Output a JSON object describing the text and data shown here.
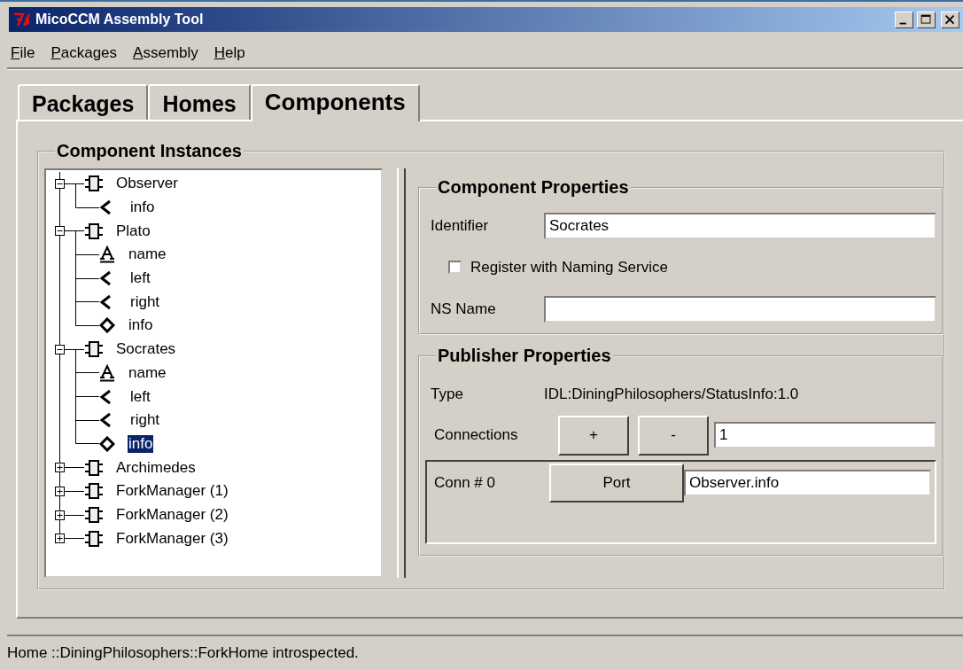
{
  "window": {
    "title": "MicoCCM Assembly Tool"
  },
  "menu": [
    {
      "label": "File"
    },
    {
      "label": "Packages"
    },
    {
      "label": "Assembly"
    },
    {
      "label": "Help"
    }
  ],
  "tabs": [
    {
      "label": "Packages",
      "selected": false
    },
    {
      "label": "Homes",
      "selected": false
    },
    {
      "label": "Components",
      "selected": true
    }
  ],
  "component_instances": {
    "title": "Component Instances",
    "tree": [
      {
        "label": "Observer",
        "kind": "component",
        "expanded": true,
        "selected": false,
        "children": [
          {
            "label": "info",
            "kind": "receptacle",
            "selected": false
          }
        ]
      },
      {
        "label": "Plato",
        "kind": "component",
        "expanded": true,
        "selected": false,
        "children": [
          {
            "label": "name",
            "kind": "attribute",
            "selected": false
          },
          {
            "label": "left",
            "kind": "receptacle",
            "selected": false
          },
          {
            "label": "right",
            "kind": "receptacle",
            "selected": false
          },
          {
            "label": "info",
            "kind": "publisher",
            "selected": false
          }
        ]
      },
      {
        "label": "Socrates",
        "kind": "component",
        "expanded": true,
        "selected": false,
        "children": [
          {
            "label": "name",
            "kind": "attribute",
            "selected": false
          },
          {
            "label": "left",
            "kind": "receptacle",
            "selected": false
          },
          {
            "label": "right",
            "kind": "receptacle",
            "selected": false
          },
          {
            "label": "info",
            "kind": "publisher",
            "selected": true
          }
        ]
      },
      {
        "label": "Archimedes",
        "kind": "component",
        "expanded": false,
        "selected": false
      },
      {
        "label": "ForkManager (1)",
        "kind": "component",
        "expanded": false,
        "selected": false
      },
      {
        "label": "ForkManager (2)",
        "kind": "component",
        "expanded": false,
        "selected": false
      },
      {
        "label": "ForkManager (3)",
        "kind": "component",
        "expanded": false,
        "selected": false
      }
    ]
  },
  "component_properties": {
    "title": "Component Properties",
    "identifier": {
      "label": "Identifier",
      "value": "Socrates"
    },
    "register": {
      "label": "Register with Naming Service",
      "checked": false
    },
    "ns_name": {
      "label": "NS Name"
    }
  },
  "publisher_properties": {
    "title": "Publisher Properties",
    "type": {
      "label": "Type",
      "value": "IDL:DiningPhilosophers/StatusInfo:1.0"
    },
    "connections": {
      "label": "Connections",
      "add": "+",
      "remove": "-",
      "value": "1"
    },
    "connection_rows": [
      {
        "label": "Conn # 0",
        "button": "Port",
        "value": "Observer.info"
      }
    ]
  },
  "status_bar": {
    "text": "Home ::DiningPhilosophers::ForkHome introspected."
  }
}
